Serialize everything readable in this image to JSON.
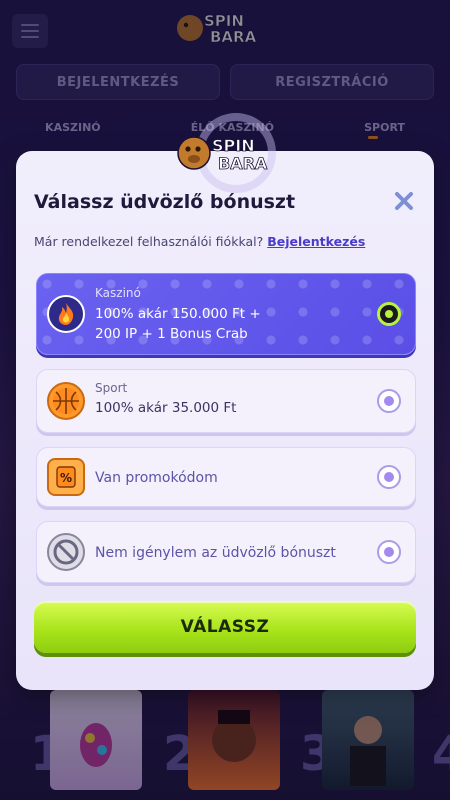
{
  "brand": {
    "logo_line1": "SPIN",
    "logo_line2": "BARA"
  },
  "header": {
    "login_label": "BEJELENTKEZÉS",
    "register_label": "REGISZTRÁCIÓ"
  },
  "nav": {
    "items": [
      "KASZINÓ",
      "ÉLŐ KASZINÓ",
      "SPORT"
    ]
  },
  "games": {
    "ranks": [
      "1",
      "2",
      "3",
      "4"
    ]
  },
  "modal": {
    "title": "Válassz üdvözlő bónuszt",
    "subtitle_text": "Már rendelkezel felhasználói fiókkal?",
    "subtitle_link": "Bejelentkezés",
    "options": [
      {
        "label": "Kaszinó",
        "line1": "100% akár 150.000 Ft +",
        "line2": "200 IP + 1 Bonus Crab",
        "icon": "fire-icon",
        "selected": true
      },
      {
        "label": "Sport",
        "line1": "100% akár 35.000 Ft",
        "icon": "basketball-icon",
        "selected": false
      },
      {
        "label": "",
        "line1": "Van promokódom",
        "icon": "promo-tag-icon",
        "selected": false
      },
      {
        "label": "",
        "line1": "Nem igénylem az üdvözlő bónuszt",
        "icon": "no-symbol-icon",
        "selected": false
      }
    ],
    "cta_label": "VÁLASSZ"
  },
  "colors": {
    "accent": "#5a4ee6",
    "cta": "#a9e51c",
    "background": "#231a52"
  }
}
